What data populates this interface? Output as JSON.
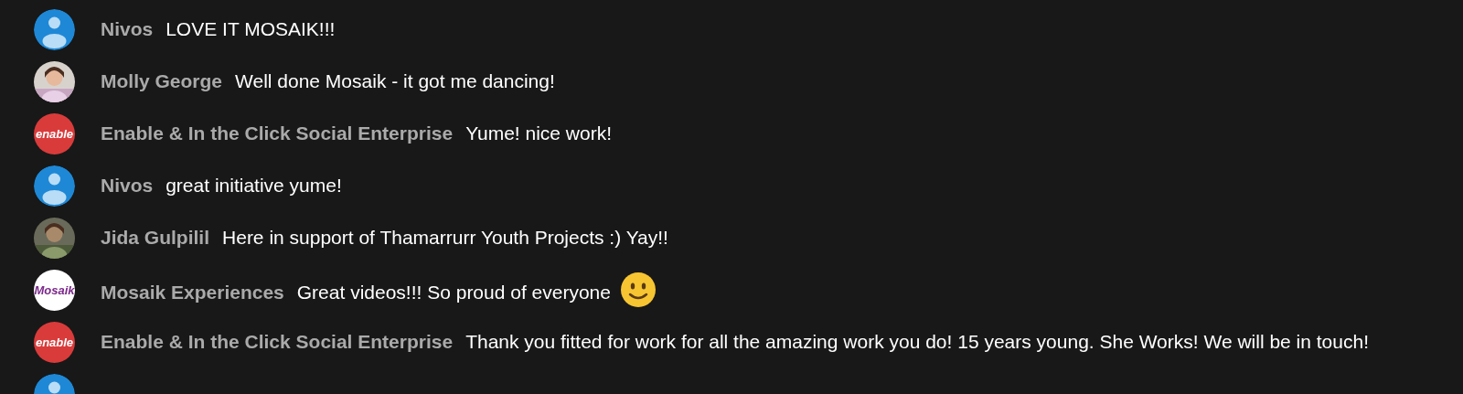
{
  "messages": [
    {
      "avatar": {
        "kind": "default"
      },
      "author": "Nivos",
      "text": "LOVE IT MOSAIK!!!"
    },
    {
      "author": "Molly George",
      "text": "Well done Mosaik - it got me dancing!"
    },
    {
      "avatar": {
        "kind": "logo",
        "logo_text": "enable",
        "color": "#d93b3b"
      },
      "author": "Enable & In the Click Social Enterprise",
      "text": "Yume! nice work!"
    },
    {
      "avatar": {
        "kind": "default"
      },
      "author": "Nivos",
      "text": "great initiative yume!"
    },
    {
      "author": "Jida Gulpilil",
      "text": "Here in support of Thamarrurr Youth Projects :) Yay!!"
    },
    {
      "avatar": {
        "kind": "logo",
        "logo_text": "Mosaik",
        "color": "#ffffff"
      },
      "author": "Mosaik Experiences",
      "text": "Great videos!!! So proud of everyone",
      "smile_emoji": true
    },
    {
      "avatar": {
        "kind": "logo",
        "logo_text": "enable",
        "color": "#d93b3b"
      },
      "author": "Enable & In the Click Social Enterprise",
      "text": "Thank you fitted for work for all the amazing work you do! 15 years young. She Works! We will be in touch!"
    },
    {
      "avatar": {
        "kind": "default"
      }
    }
  ]
}
